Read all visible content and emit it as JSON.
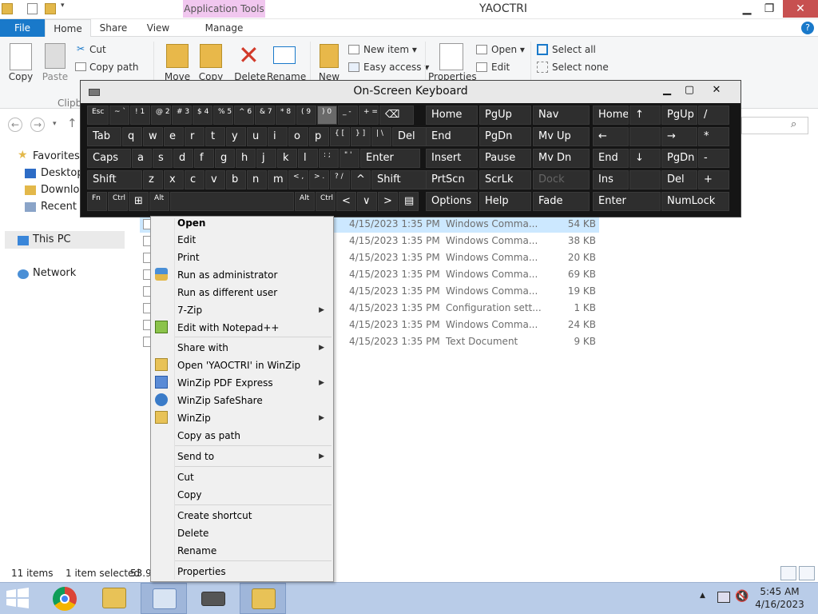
{
  "window": {
    "title": "YAOCTRI",
    "app_tools": "Application Tools",
    "min": "▁",
    "max": "❐",
    "close": "✕"
  },
  "ribbon_tabs": {
    "file": "File",
    "home": "Home",
    "share": "Share",
    "view": "View",
    "manage": "Manage"
  },
  "ribbon": {
    "copy": "Copy",
    "paste": "Paste",
    "cut": "Cut",
    "copy_path": "Copy path",
    "clipboard": "Clipb",
    "move": "Move",
    "copy_to": "Copy",
    "delete": "Delete",
    "rename": "Rename",
    "new": "New",
    "new_item": "New item ▾",
    "easy_access": "Easy access ▾",
    "properties": "Properties",
    "open": "Open ▾",
    "edit": "Edit",
    "select_all": "Select all",
    "select_none": "Select none"
  },
  "nav": {
    "favorites": "Favorites",
    "desktop": "Desktop",
    "downloads": "Downloa",
    "recent": "Recent pl",
    "this_pc": "This PC",
    "network": "Network"
  },
  "files": [
    {
      "date": "4/15/2023 1:35 PM",
      "type": "Windows Comma...",
      "size": "54 KB",
      "selected": true
    },
    {
      "date": "4/15/2023 1:35 PM",
      "type": "Windows Comma...",
      "size": "38 KB"
    },
    {
      "date": "4/15/2023 1:35 PM",
      "type": "Windows Comma...",
      "size": "20 KB"
    },
    {
      "date": "4/15/2023 1:35 PM",
      "type": "Windows Comma...",
      "size": "69 KB"
    },
    {
      "date": "4/15/2023 1:35 PM",
      "type": "Windows Comma...",
      "size": "19 KB"
    },
    {
      "date": "4/15/2023 1:35 PM",
      "type": "Configuration sett...",
      "size": "1 KB"
    },
    {
      "date": "4/15/2023 1:35 PM",
      "type": "Windows Comma...",
      "size": "24 KB"
    },
    {
      "date": "4/15/2023 1:35 PM",
      "type": "Text Document",
      "size": "9 KB"
    }
  ],
  "status": {
    "items": "11 items",
    "selected": "1 item selected",
    "size": "53.9"
  },
  "osk": {
    "title": "On-Screen Keyboard",
    "min": "▁",
    "max": "▢",
    "close": "✕"
  },
  "keys": [
    [
      "Esc",
      "~ `",
      "! 1",
      "@ 2",
      "# 3",
      "$ 4",
      "% 5",
      "^ 6",
      "& 7",
      "* 8",
      "( 9",
      ") 0",
      "_ -",
      "+ =",
      "⌫"
    ],
    [
      "Tab",
      "q",
      "w",
      "e",
      "r",
      "t",
      "y",
      "u",
      "i",
      "o",
      "p",
      "{ [",
      "} ]",
      "| \\",
      "Del"
    ],
    [
      "Caps",
      "a",
      "s",
      "d",
      "f",
      "g",
      "h",
      "j",
      "k",
      "l",
      ": ;",
      "\" '",
      "Enter"
    ],
    [
      "Shift",
      "z",
      "x",
      "c",
      "v",
      "b",
      "n",
      "m",
      "< ,",
      "> .",
      "? /",
      "^",
      "Shift"
    ],
    [
      "Fn",
      "Ctrl",
      "⊞",
      "Alt",
      "",
      "Alt",
      "Ctrl",
      "<",
      "∨",
      ">",
      "▤"
    ]
  ],
  "nav_keys": [
    [
      "Home",
      "PgUp",
      "Nav"
    ],
    [
      "End",
      "PgDn",
      "Mv Up"
    ],
    [
      "Insert",
      "Pause",
      "Mv Dn"
    ],
    [
      "PrtScn",
      "ScrLk",
      "Dock"
    ],
    [
      "Options",
      "Help",
      "Fade"
    ]
  ],
  "numpad_keys": [
    [
      "Home",
      "↑",
      "PgUp",
      "/"
    ],
    [
      "←",
      "",
      "→",
      "*"
    ],
    [
      "End",
      "↓",
      "PgDn",
      "-"
    ],
    [
      "Ins",
      "",
      "Del",
      "+"
    ],
    [
      "Enter",
      "",
      "NumLock",
      ""
    ]
  ],
  "context_menu": {
    "open": "Open",
    "edit": "Edit",
    "print": "Print",
    "run_admin": "Run as administrator",
    "run_other": "Run as different user",
    "seven_zip": "7-Zip",
    "notepad": "Edit with Notepad++",
    "share_with": "Share with",
    "open_winzip": "Open 'YAOCTRI' in WinZip",
    "winzip_pdf": "WinZip PDF Express",
    "winzip_safe": "WinZip SafeShare",
    "winzip": "WinZip",
    "copy_as_path": "Copy as path",
    "send_to": "Send to",
    "cut": "Cut",
    "copy": "Copy",
    "create_shortcut": "Create shortcut",
    "delete": "Delete",
    "rename": "Rename",
    "properties": "Properties",
    "submenu_arrow": "▶"
  },
  "clock": {
    "time": "5:45 AM",
    "date": "4/16/2023"
  },
  "colors": {
    "accent": "#1979ca",
    "selection": "#cce8ff",
    "taskbar": "#b9cce8"
  }
}
